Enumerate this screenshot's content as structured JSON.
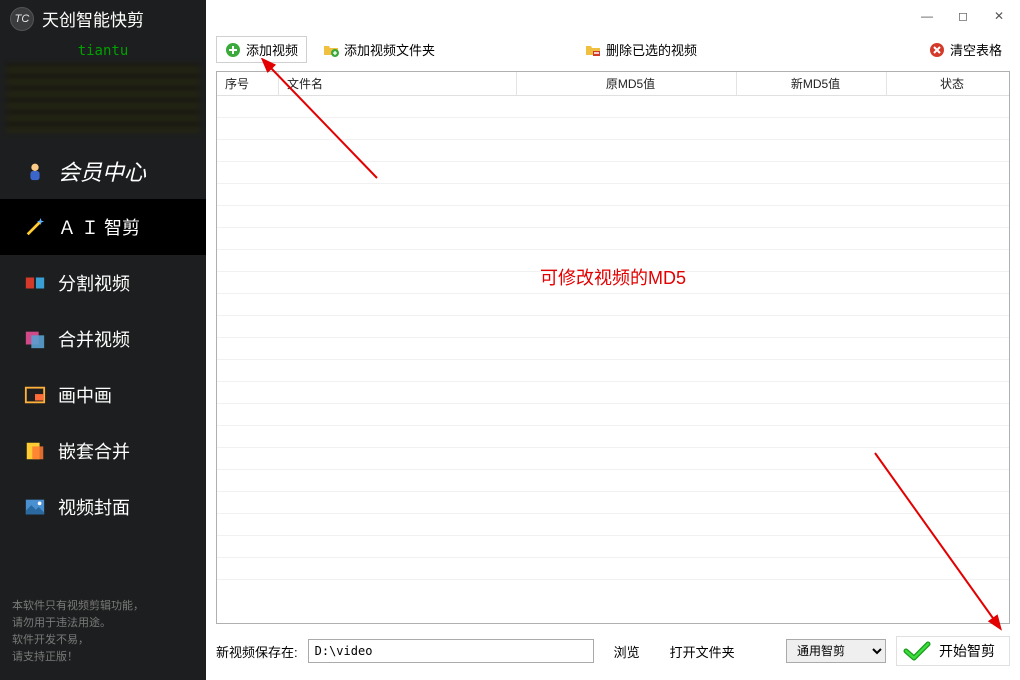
{
  "app": {
    "title": "天创智能快剪",
    "logo_text": "TC"
  },
  "user": {
    "name": "tiantu"
  },
  "sidebar": {
    "items": [
      {
        "label": "会员中心"
      },
      {
        "label": "Ａ Ｉ 智剪"
      },
      {
        "label": "分割视频"
      },
      {
        "label": "合并视频"
      },
      {
        "label": "画中画"
      },
      {
        "label": "嵌套合并"
      },
      {
        "label": "视频封面"
      }
    ],
    "footer_line1": "本软件只有视频剪辑功能，",
    "footer_line2": "请勿用于违法用途。",
    "footer_line3": "软件开发不易，",
    "footer_line4": "请支持正版！"
  },
  "toolbar": {
    "add_video": "添加视频",
    "add_folder": "添加视频文件夹",
    "delete_selected": "删除已选的视频",
    "clear_table": "清空表格"
  },
  "table": {
    "columns": {
      "index": "序号",
      "filename": "文件名",
      "src_md5": "原MD5值",
      "new_md5": "新MD5值",
      "status": "状态"
    }
  },
  "annotation": {
    "text": "可修改视频的MD5"
  },
  "bottom": {
    "save_label": "新视频保存在:",
    "save_path": "D:\\video",
    "browse": "浏览",
    "open_folder": "打开文件夹",
    "mode": "通用智剪",
    "start": "开始智剪"
  },
  "window_controls": {
    "min": "—",
    "max": "◻",
    "close": "✕"
  }
}
